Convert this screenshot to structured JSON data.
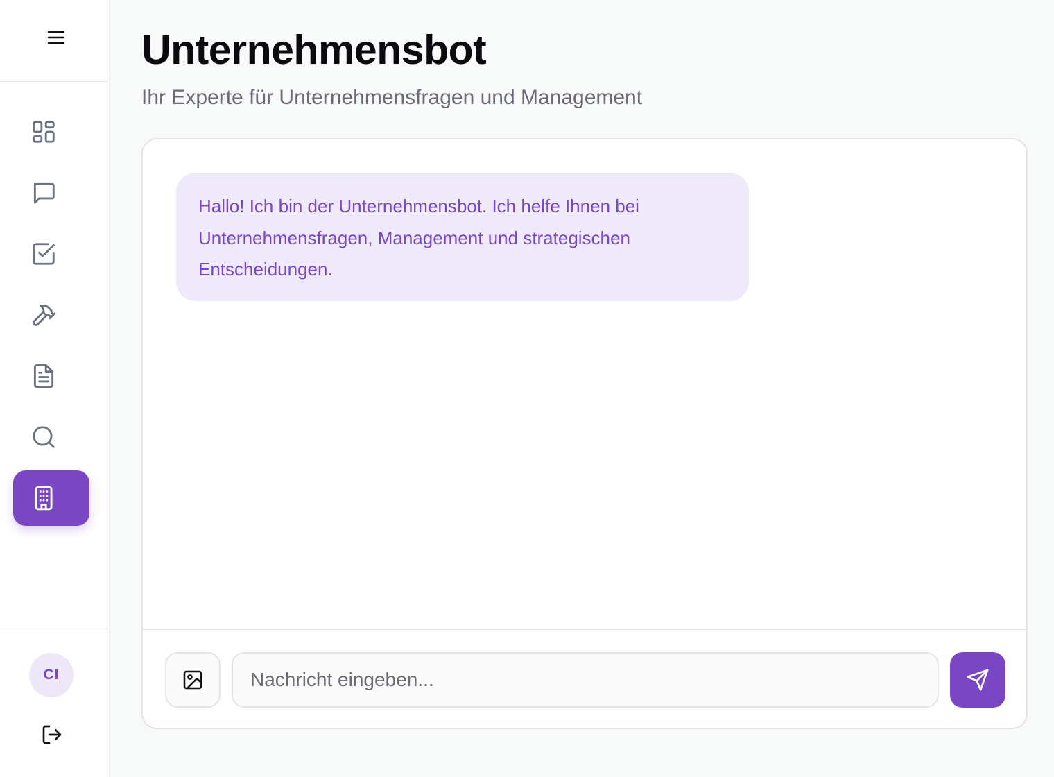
{
  "header": {
    "title": "Unternehmensbot",
    "subtitle": "Ihr Experte für Unternehmensfragen und Management"
  },
  "sidebar": {
    "menu_icon": "hamburger-menu-icon",
    "items": [
      {
        "icon": "dashboard-grid-icon",
        "active": false
      },
      {
        "icon": "chat-bubble-icon",
        "active": false
      },
      {
        "icon": "checkbox-icon",
        "active": false
      },
      {
        "icon": "hammer-icon",
        "active": false
      },
      {
        "icon": "document-icon",
        "active": false
      },
      {
        "icon": "search-icon",
        "active": false
      },
      {
        "icon": "building-icon",
        "active": true
      }
    ],
    "user": {
      "initials": "CI"
    },
    "logout_icon": "logout-icon"
  },
  "chat": {
    "messages": [
      {
        "sender": "bot",
        "text": "Hallo! Ich bin der Unternehmensbot. Ich helfe Ihnen bei Unternehmensfragen, Management und strategischen Entscheidungen."
      }
    ],
    "input": {
      "placeholder": "Nachricht eingeben...",
      "value": ""
    },
    "image_button_icon": "image-icon",
    "send_button_icon": "send-icon"
  },
  "colors": {
    "accent": "#7a47c4",
    "bubble_bg": "#efeafa",
    "avatar_bg": "#ede7f8",
    "border": "#e4e4e7",
    "page_bg": "#f8f9f9"
  }
}
